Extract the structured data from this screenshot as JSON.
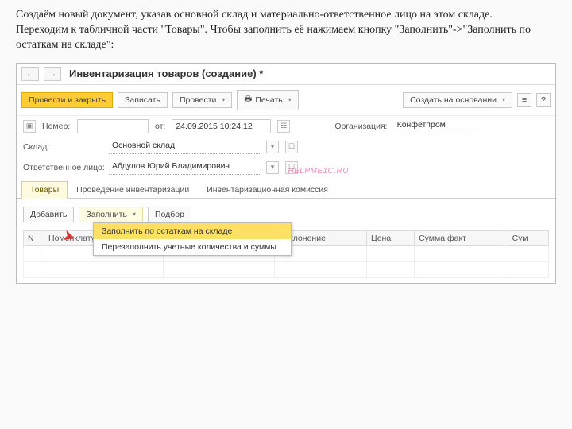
{
  "instruction": "Создаём новый документ, указав основной склад и материально-ответственное лицо на этом складе.\nПереходим к табличной части \"Товары\". Чтобы заполнить её нажимаем кнопку \"Заполнить\"->\"Заполнить по остаткам на складе\":",
  "header": {
    "title": "Инвентаризация товаров (создание) *"
  },
  "toolbar": {
    "post_close": "Провести и закрыть",
    "save": "Записать",
    "post": "Провести",
    "print": "Печать",
    "create_based": "Создать на основании"
  },
  "form": {
    "number_label": "Номер:",
    "number_value": "",
    "from_label": "от:",
    "from_value": "24.09.2015 10:24:12",
    "org_label": "Организация:",
    "org_value": "Конфетпром",
    "warehouse_label": "Склад:",
    "warehouse_value": "Основной склад",
    "resp_label": "Ответственное лицо:",
    "resp_value": "Абдулов Юрий Владимирович"
  },
  "tabs": {
    "t1": "Товары",
    "t2": "Проведение инвентаризации",
    "t3": "Инвентаризационная комиссия"
  },
  "subtool": {
    "add": "Добавить",
    "fill": "Заполнить",
    "select": "Подбор"
  },
  "dropdown": {
    "i1": "Заполнить по остаткам на складе",
    "i2": "Перезаполнить учетные количества и суммы"
  },
  "cols": {
    "n": "N",
    "nom": "Номенклатура",
    "dev": "Отклонение",
    "price": "Цена",
    "sum_fact": "Сумма факт",
    "sum": "Сум"
  },
  "watermark": "HELPME1C.RU"
}
